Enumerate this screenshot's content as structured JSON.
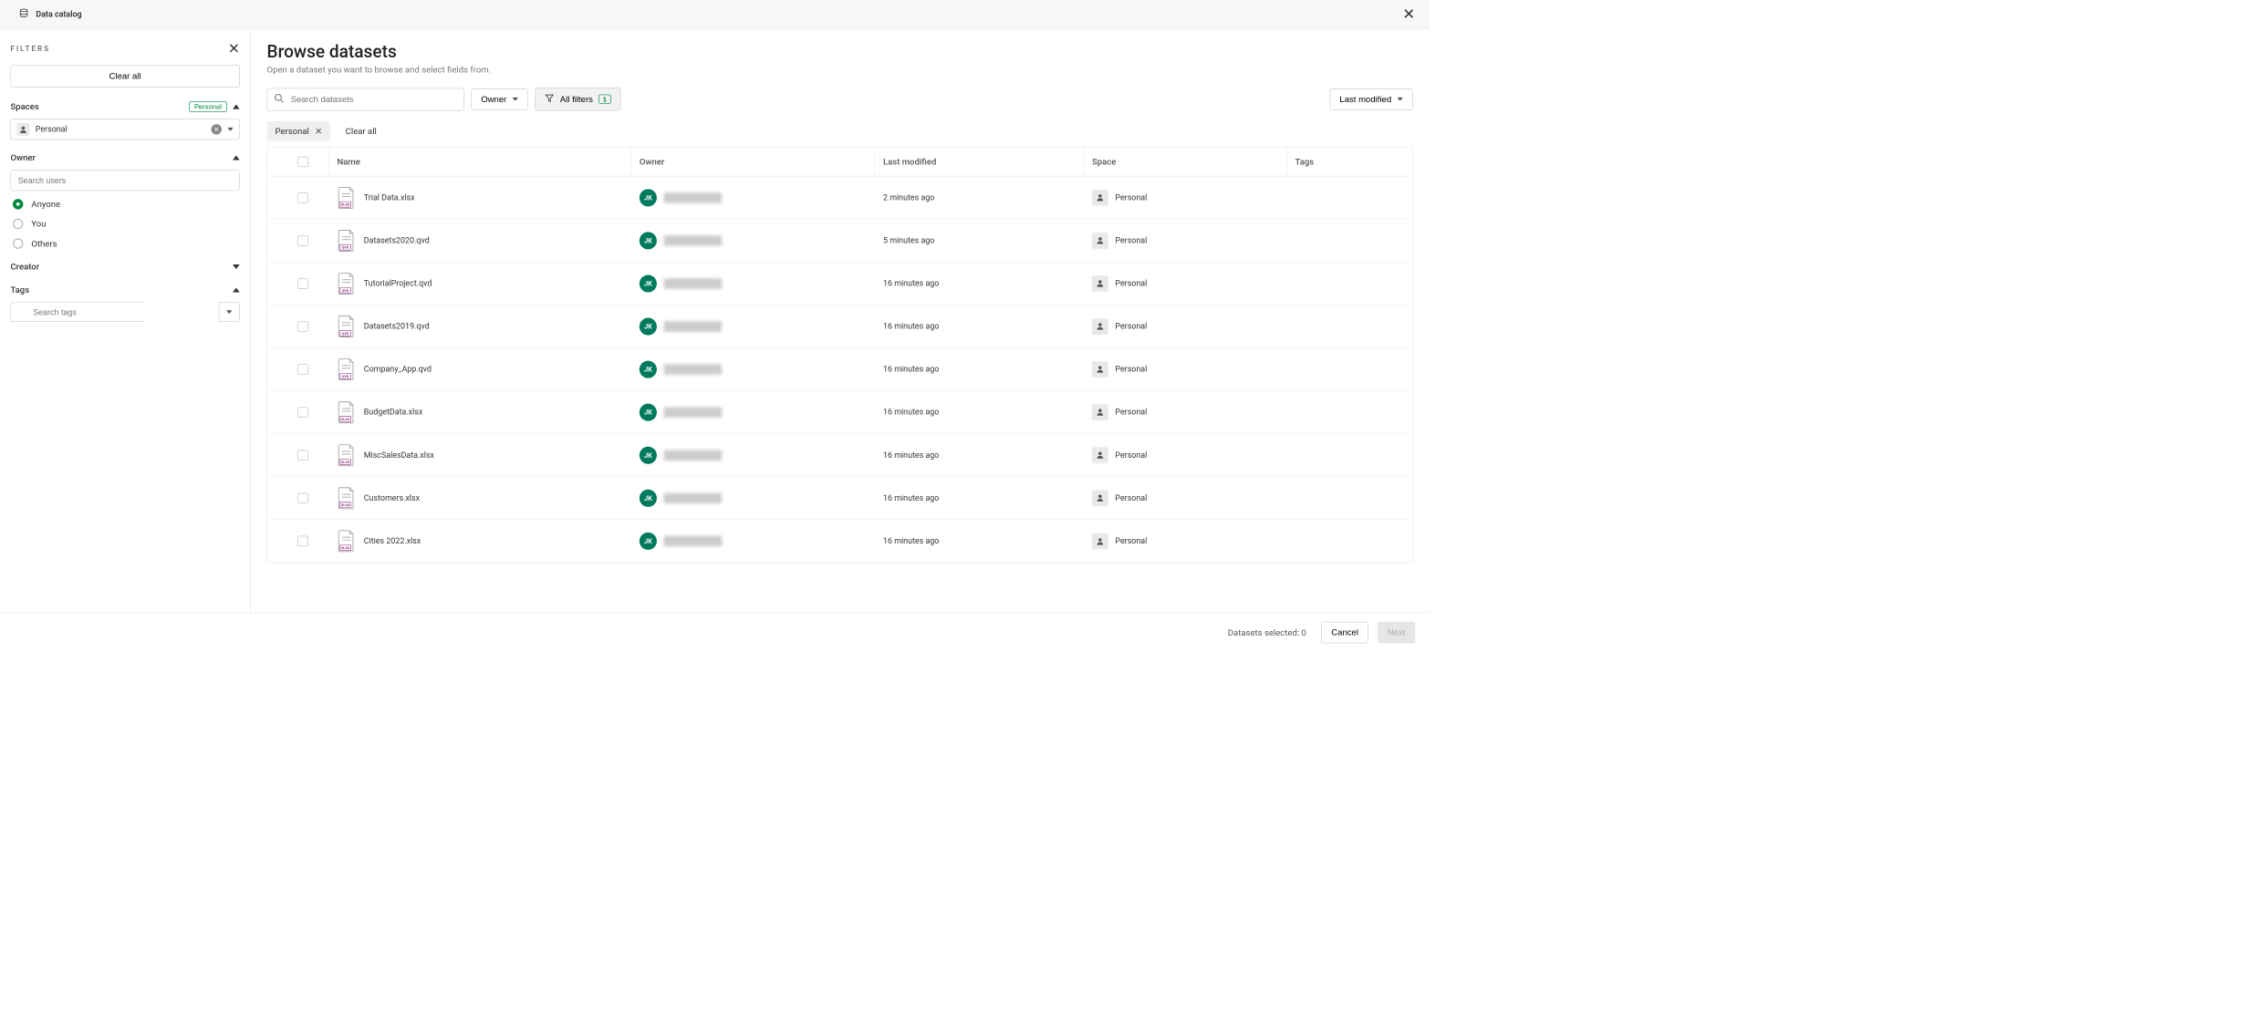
{
  "topbar": {
    "title": "Data catalog"
  },
  "sidebar": {
    "filters_label": "FILTERS",
    "clear_all": "Clear all",
    "spaces": {
      "title": "Spaces",
      "badge": "Personal",
      "selected": "Personal"
    },
    "owner": {
      "title": "Owner",
      "search_placeholder": "Search users",
      "options": {
        "anyone": "Anyone",
        "you": "You",
        "others": "Others"
      },
      "selected": "anyone"
    },
    "creator": {
      "title": "Creator"
    },
    "tags": {
      "title": "Tags",
      "search_placeholder": "Search tags"
    }
  },
  "content": {
    "title": "Browse datasets",
    "subtitle": "Open a dataset you want to browse and select fields from.",
    "search_placeholder": "Search datasets",
    "owner_dropdown": "Owner",
    "all_filters": "All filters",
    "all_filters_count": "1",
    "sort_label": "Last modified",
    "pill": "Personal",
    "clear_all": "Clear all"
  },
  "table": {
    "headers": {
      "name": "Name",
      "owner": "Owner",
      "modified": "Last modified",
      "space": "Space",
      "tags": "Tags"
    },
    "rows": [
      {
        "name": "Trial Data.xlsx",
        "type": "xlsx",
        "owner_initials": "JK",
        "modified": "2 minutes ago",
        "space": "Personal"
      },
      {
        "name": "Datasets2020.qvd",
        "type": "qvd",
        "owner_initials": "JK",
        "modified": "5 minutes ago",
        "space": "Personal"
      },
      {
        "name": "TutorialProject.qvd",
        "type": "qvd",
        "owner_initials": "JK",
        "modified": "16 minutes ago",
        "space": "Personal"
      },
      {
        "name": "Datasets2019.qvd",
        "type": "qvd",
        "owner_initials": "JK",
        "modified": "16 minutes ago",
        "space": "Personal"
      },
      {
        "name": "Company_App.qvd",
        "type": "qvd",
        "owner_initials": "JK",
        "modified": "16 minutes ago",
        "space": "Personal"
      },
      {
        "name": "BudgetData.xlsx",
        "type": "xlsx",
        "owner_initials": "JK",
        "modified": "16 minutes ago",
        "space": "Personal"
      },
      {
        "name": "MiscSalesData.xlsx",
        "type": "xlsx",
        "owner_initials": "JK",
        "modified": "16 minutes ago",
        "space": "Personal"
      },
      {
        "name": "Customers.xlsx",
        "type": "xlsx",
        "owner_initials": "JK",
        "modified": "16 minutes ago",
        "space": "Personal"
      },
      {
        "name": "Cities 2022.xlsx",
        "type": "xlsx",
        "owner_initials": "JK",
        "modified": "16 minutes ago",
        "space": "Personal"
      }
    ]
  },
  "footer": {
    "selected_label": "Datasets selected:",
    "selected_count": "0",
    "cancel": "Cancel",
    "next": "Next"
  }
}
